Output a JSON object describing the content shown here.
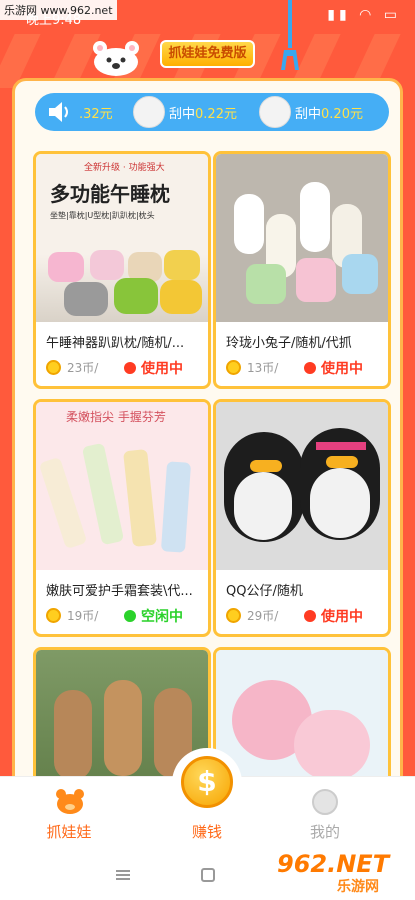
{
  "status_bar": {
    "time": "晚上9:48",
    "watermark": "乐游网 www.962.net"
  },
  "header": {
    "title": "抓娃娃免费版"
  },
  "ticker": [
    {
      "prefix": "",
      "amount": ".32元"
    },
    {
      "prefix": "刮中",
      "amount": "0.22元"
    },
    {
      "prefix": "刮中",
      "amount": "0.20元"
    }
  ],
  "products": [
    {
      "name": "午睡神器趴趴枕/随机/...",
      "price": "23币/",
      "status": "使用中",
      "status_color": "#ff3b22",
      "image_lines": [
        "全新升级 · 功能强大",
        "多功能午睡枕",
        "坐垫|靠枕|U型枕|趴趴枕|枕头"
      ]
    },
    {
      "name": "玲珑小兔子/随机/代抓",
      "price": "13币/",
      "status": "使用中",
      "status_color": "#ff3b22",
      "image_lines": []
    },
    {
      "name": "嫩肤可爱护手霜套装\\代...",
      "price": "19币/",
      "status": "空闲中",
      "status_color": "#2bd22b",
      "image_lines": [
        "柔嫩指尖 手握芬芳"
      ]
    },
    {
      "name": "QQ公仔/随机",
      "price": "29币/",
      "status": "使用中",
      "status_color": "#ff3b22",
      "image_lines": []
    },
    {
      "name": "",
      "price": "",
      "status": "",
      "status_color": "",
      "image_lines": []
    },
    {
      "name": "",
      "price": "",
      "status": "",
      "status_color": "",
      "image_lines": []
    }
  ],
  "nav": {
    "home": "抓娃娃",
    "earn": "赚钱",
    "earn_symbol": "$",
    "mine": "我的"
  },
  "watermark_br": {
    "main": "962.NET",
    "sub": "乐游网"
  },
  "colors": {
    "background": "#ff5a3c",
    "ticker": "#45aef5",
    "card_border": "#ffc23a",
    "accent_text": "#ff3b22"
  }
}
